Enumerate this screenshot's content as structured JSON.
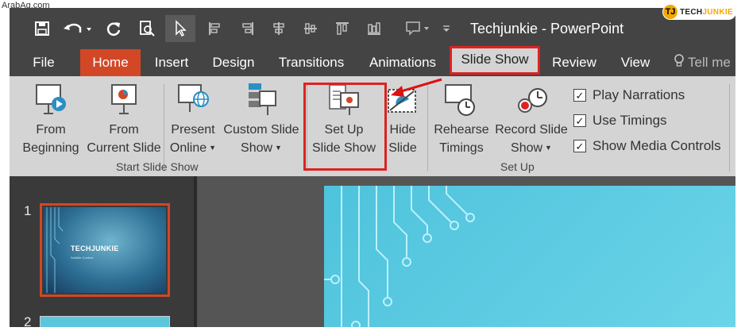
{
  "watermark": {
    "site": "ArabAq.com",
    "brand_prefix": "TECH",
    "brand_suffix": "JUNKIE",
    "brand_mark": "TJ"
  },
  "window": {
    "title": "Techjunkie - PowerPoint"
  },
  "qat": [
    "save-icon",
    "undo-icon",
    "redo-icon",
    "print-preview-icon",
    "pointer-icon",
    "align-left-icon",
    "align-right-icon",
    "align-center-icon",
    "align-middle-icon",
    "align-top-icon",
    "distribute-icon",
    "comment-icon",
    "more-icon"
  ],
  "tabs": {
    "file": "File",
    "home": "Home",
    "insert": "Insert",
    "design": "Design",
    "transitions": "Transitions",
    "animations": "Animations",
    "slide_show": "Slide Show",
    "review": "Review",
    "view": "View",
    "tell_me": "Tell me"
  },
  "ribbon": {
    "from_beginning": [
      "From",
      "Beginning"
    ],
    "from_current": [
      "From",
      "Current Slide"
    ],
    "present_online": [
      "Present",
      "Online"
    ],
    "custom_show": [
      "Custom Slide",
      "Show"
    ],
    "setup_show": [
      "Set Up",
      "Slide Show"
    ],
    "hide_slide": [
      "Hide",
      "Slide"
    ],
    "rehearse": [
      "Rehearse",
      "Timings"
    ],
    "record": [
      "Record Slide",
      "Show"
    ],
    "group_start": "Start Slide Show",
    "group_setup": "Set Up",
    "checks": [
      {
        "label": "Play Narrations",
        "checked": true
      },
      {
        "label": "Use Timings",
        "checked": true
      },
      {
        "label": "Show Media Controls",
        "checked": true
      }
    ]
  },
  "slides": {
    "numbers": [
      "1",
      "2"
    ],
    "thumb1_title": "TECHJUNKIE",
    "thumb1_sub": "Subtitle Content"
  },
  "colors": {
    "accent": "#d24726",
    "highlight": "#dd2222",
    "slide_bg": "#5bc6dc"
  }
}
